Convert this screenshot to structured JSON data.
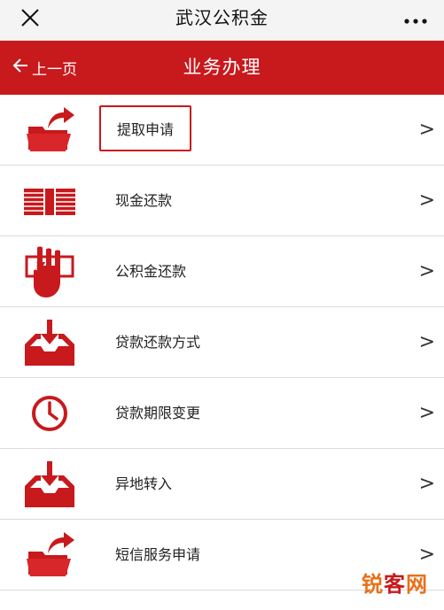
{
  "topbar": {
    "title": "武汉公积金",
    "close_icon": "close-icon",
    "more_icon": "more-icon"
  },
  "header": {
    "back_label": "上一页",
    "title": "业务办理",
    "color": "#c8191d"
  },
  "menu": [
    {
      "label": "提取申请",
      "icon": "folder-share-icon",
      "highlighted": true
    },
    {
      "label": "现金还款",
      "icon": "cash-stack-icon"
    },
    {
      "label": "公积金还款",
      "icon": "hand-yuan-icon"
    },
    {
      "label": "贷款还款方式",
      "icon": "inbox-download-icon"
    },
    {
      "label": "贷款期限变更",
      "icon": "clock-icon"
    },
    {
      "label": "异地转入",
      "icon": "inbox-download-icon"
    },
    {
      "label": "短信服务申请",
      "icon": "folder-share-icon"
    }
  ],
  "chevron": ">",
  "watermark": {
    "part1": "锐",
    "part2": "客",
    "part3": "网"
  }
}
